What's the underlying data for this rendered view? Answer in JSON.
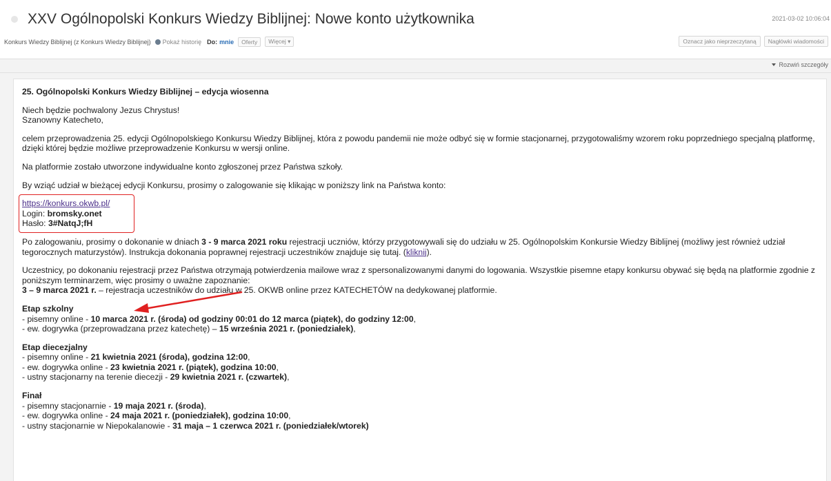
{
  "header": {
    "subject": "XXV Ogólnopolski Konkurs Wiedzy Biblijnej: Nowe konto użytkownika",
    "date": "2021-03-02 10:06:04",
    "sender": "Konkurs Wiedzy Biblijnej (z Konkurs Wiedzy Biblijnej)",
    "history_label": "Pokaż historię",
    "to_label": "Do:",
    "to_value": "mnie",
    "offers_label": "Oferty",
    "more_label": "Więcej ▾",
    "mark_unread_label": "Oznacz jako nieprzeczytaną",
    "headers_label": "Nagłówki wiadomości",
    "details_label": "Rozwiń szczegóły"
  },
  "message": {
    "title": "25. Ogólnopolski Konkurs Wiedzy Biblijnej – edycja wiosenna",
    "greeting1": "Niech będzie pochwalony Jezus Chrystus!",
    "greeting2": "Szanowny Katecheto,",
    "p1": "celem przeprowadzenia 25. edycji Ogólnopolskiego Konkursu Wiedzy Biblijnej, która z powodu pandemii nie może odbyć się w formie stacjonarnej, przygotowaliśmy wzorem roku poprzedniego specjalną platformę, dzięki której będzie możliwe przeprowadzenie Konkursu w wersji online.",
    "p2": "Na platformie zostało utworzone indywidualne konto zgłoszonej przez Państwa szkoły.",
    "p3": "By wziąć udział w bieżącej edycji Konkursu, prosimy o zalogowanie się klikając w poniższy link na Państwa konto:",
    "link": "https://konkurs.okwb.pl/",
    "login_label": "Login: ",
    "login_value": "bromsky.onet",
    "password_label": "Hasło: ",
    "password_value": "3#NatqJ;fH",
    "p4_a": "Po zalogowaniu, prosimy o dokonanie w dniach ",
    "p4_b": "3 - 9 marca 2021 roku",
    "p4_c": " rejestracji uczniów, którzy przygotowywali się do udziału w 25. Ogólnopolskim Konkursie Wiedzy Biblijnej (możliwy jest również udział tegorocznych maturzystów). Instrukcja dokonania poprawnej rejestracji uczestników znajduje się tutaj. (",
    "p4_link": "kliknij",
    "p4_d": ").",
    "p5": "Uczestnicy, po dokonaniu rejestracji przez Państwa otrzymają potwierdzenia mailowe wraz z spersonalizowanymi danymi do logowania. Wszystkie pisemne etapy konkursu obywać się będą na platformie zgodnie z poniższym terminarzem, więc prosimy o uważne zapoznanie:",
    "p5_bold": "3 – 9 marca 2021 r.",
    "p5_rest": " – rejestracja uczestników do udziału w 25. OKWB online przez KATECHETÓW na dedykowanej platformie.",
    "school_head": "Etap szkolny",
    "school_1a": "- pisemny online - ",
    "school_1b": "10 marca 2021 r. (środa) od godziny 00:01 do 12 marca (piątek), do godziny 12:00",
    "school_1c": ",",
    "school_2a": "- ew. dogrywka (przeprowadzana przez katechetę) – ",
    "school_2b": "15 września 2021 r. (poniedziałek)",
    "school_2c": ",",
    "dioc_head": "Etap diecezjalny",
    "dioc_1a": "- pisemny online - ",
    "dioc_1b": "21 kwietnia 2021 (środa), godzina 12:00",
    "dioc_1c": ",",
    "dioc_2a": "- ew. dogrywka online - ",
    "dioc_2b": "23 kwietnia 2021 r. (piątek), godzina 10:00",
    "dioc_2c": ",",
    "dioc_3a": "- ustny stacjonarny na terenie diecezji - ",
    "dioc_3b": "29 kwietnia 2021 r. (czwartek)",
    "dioc_3c": ",",
    "final_head": "Finał",
    "final_1a": "- pisemny stacjonarnie - ",
    "final_1b": "19 maja 2021 r. (środa)",
    "final_1c": ",",
    "final_2a": "- ew. dogrywka online - ",
    "final_2b": "24 maja 2021 r. (poniedziałek), godzina 10:00",
    "final_2c": ",",
    "final_3a": "- ustny stacjonarnie w Niepokalanowie - ",
    "final_3b": "31 maja – 1 czerwca 2021 r. (poniedziałek/wtorek)"
  },
  "colors": {
    "link": "#4b2f8a",
    "highlight": "#e02020",
    "accent": "#2a6db5"
  }
}
